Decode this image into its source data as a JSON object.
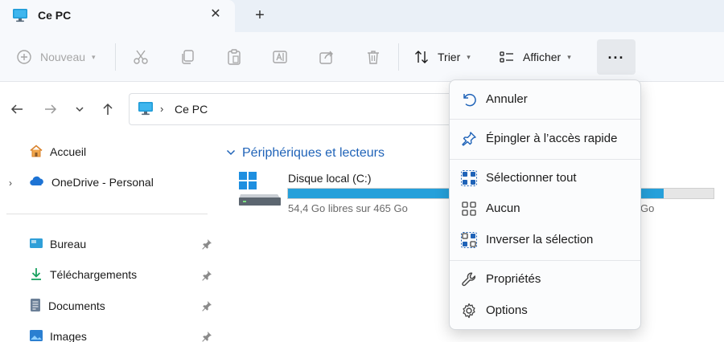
{
  "tab": {
    "title": "Ce PC",
    "close_glyph": "✕"
  },
  "new_tab_glyph": "+",
  "toolbar": {
    "new_label": "Nouveau",
    "sort_label": "Trier",
    "view_label": "Afficher",
    "more_glyph": "..."
  },
  "address": {
    "separator": "›",
    "crumb": "Ce PC"
  },
  "sidebar": {
    "items": [
      {
        "label": "Accueil",
        "icon": "home-icon"
      },
      {
        "label": "OneDrive - Personal",
        "icon": "cloud-icon"
      },
      {
        "label": "Bureau",
        "icon": "desktop-folder-icon"
      },
      {
        "label": "Téléchargements",
        "icon": "download-icon"
      },
      {
        "label": "Documents",
        "icon": "documents-icon"
      },
      {
        "label": "Images",
        "icon": "images-icon"
      }
    ]
  },
  "content": {
    "group_title": "Périphériques et lecteurs",
    "drive": {
      "name": "Disque local (C:)",
      "free_text": "54,4 Go libres sur 465 Go",
      "free_tail": "Go",
      "used_fraction": 0.883
    }
  },
  "menu": {
    "items": [
      {
        "label": "Annuler",
        "icon": "undo-icon"
      },
      {
        "label": "Épingler à l’accès rapide",
        "icon": "pin-icon"
      },
      {
        "label": "Sélectionner tout",
        "icon": "select-all-icon"
      },
      {
        "label": "Aucun",
        "icon": "select-none-icon"
      },
      {
        "label": "Inverser la sélection",
        "icon": "invert-selection-icon"
      },
      {
        "label": "Propriétés",
        "icon": "wrench-icon"
      },
      {
        "label": "Options",
        "icon": "gear-icon"
      }
    ]
  },
  "colors": {
    "accent": "#1f63b8",
    "drive_bar": "#26a0da",
    "disabled": "#a6a6a6"
  }
}
